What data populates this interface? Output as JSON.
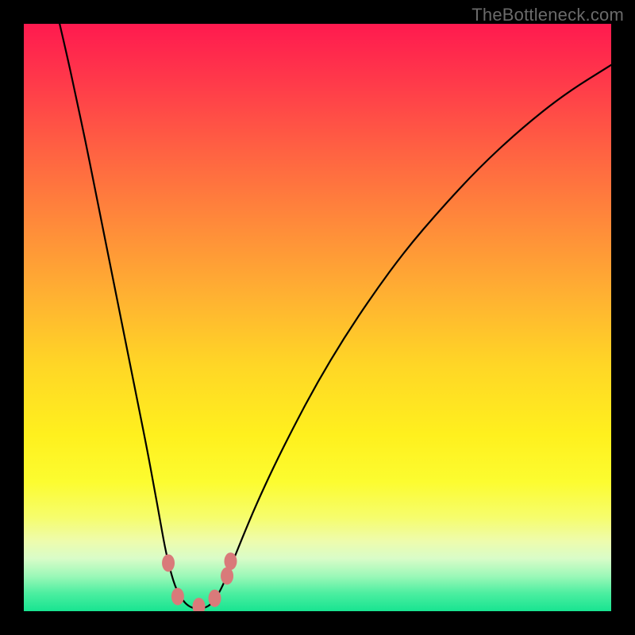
{
  "watermark": "TheBottleneck.com",
  "chart_data": {
    "type": "line",
    "title": "",
    "xlabel": "",
    "ylabel": "",
    "xlim": [
      0,
      1
    ],
    "ylim": [
      0,
      1
    ],
    "grid": false,
    "legend": false,
    "background": "rainbow-vertical-gradient",
    "series": [
      {
        "name": "bottleneck-curve",
        "color": "#000000",
        "points": [
          {
            "x": 0.061,
            "y": 1.0
          },
          {
            "x": 0.075,
            "y": 0.94
          },
          {
            "x": 0.09,
            "y": 0.87
          },
          {
            "x": 0.105,
            "y": 0.8
          },
          {
            "x": 0.12,
            "y": 0.725
          },
          {
            "x": 0.135,
            "y": 0.65
          },
          {
            "x": 0.15,
            "y": 0.575
          },
          {
            "x": 0.165,
            "y": 0.5
          },
          {
            "x": 0.18,
            "y": 0.425
          },
          {
            "x": 0.195,
            "y": 0.35
          },
          {
            "x": 0.21,
            "y": 0.275
          },
          {
            "x": 0.222,
            "y": 0.21
          },
          {
            "x": 0.232,
            "y": 0.155
          },
          {
            "x": 0.24,
            "y": 0.11
          },
          {
            "x": 0.249,
            "y": 0.07
          },
          {
            "x": 0.26,
            "y": 0.035
          },
          {
            "x": 0.275,
            "y": 0.012
          },
          {
            "x": 0.29,
            "y": 0.004
          },
          {
            "x": 0.305,
            "y": 0.004
          },
          {
            "x": 0.32,
            "y": 0.012
          },
          {
            "x": 0.335,
            "y": 0.035
          },
          {
            "x": 0.352,
            "y": 0.075
          },
          {
            "x": 0.372,
            "y": 0.125
          },
          {
            "x": 0.395,
            "y": 0.18
          },
          {
            "x": 0.425,
            "y": 0.245
          },
          {
            "x": 0.46,
            "y": 0.315
          },
          {
            "x": 0.5,
            "y": 0.39
          },
          {
            "x": 0.545,
            "y": 0.465
          },
          {
            "x": 0.595,
            "y": 0.54
          },
          {
            "x": 0.65,
            "y": 0.615
          },
          {
            "x": 0.71,
            "y": 0.685
          },
          {
            "x": 0.775,
            "y": 0.755
          },
          {
            "x": 0.845,
            "y": 0.82
          },
          {
            "x": 0.92,
            "y": 0.88
          },
          {
            "x": 1.0,
            "y": 0.93
          }
        ]
      }
    ],
    "data_markers": [
      {
        "x": 0.246,
        "y": 0.082,
        "color": "#d97a7a"
      },
      {
        "x": 0.262,
        "y": 0.025,
        "color": "#d97a7a"
      },
      {
        "x": 0.298,
        "y": 0.008,
        "color": "#d97a7a"
      },
      {
        "x": 0.325,
        "y": 0.022,
        "color": "#d97a7a"
      },
      {
        "x": 0.346,
        "y": 0.06,
        "color": "#d97a7a"
      },
      {
        "x": 0.352,
        "y": 0.085,
        "color": "#d97a7a"
      }
    ]
  }
}
